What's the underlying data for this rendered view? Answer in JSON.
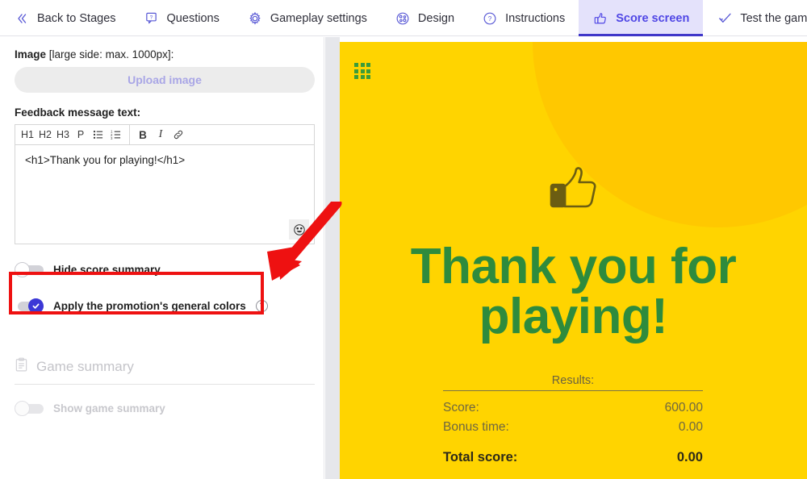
{
  "tabs": [
    {
      "label": "Back to Stages",
      "icon": "chevrons-left-icon",
      "active": false
    },
    {
      "label": "Questions",
      "icon": "question-bubble-icon",
      "active": false
    },
    {
      "label": "Gameplay settings",
      "icon": "gear-icon",
      "active": false
    },
    {
      "label": "Design",
      "icon": "palette-icon",
      "active": false
    },
    {
      "label": "Instructions",
      "icon": "question-circle-icon",
      "active": false
    },
    {
      "label": "Score screen",
      "icon": "thumbs-up-icon",
      "active": true
    },
    {
      "label": "Test the game",
      "icon": "check-wave-icon",
      "active": false
    }
  ],
  "editor": {
    "image_label_strong": "Image",
    "image_label_rest": " [large side: max. 1000px]:",
    "upload_button": "Upload image",
    "feedback_label": "Feedback message text:",
    "toolbar": [
      "H1",
      "H2",
      "H3",
      "P",
      "bulleted-list-icon",
      "numbered-list-icon",
      "B",
      "I",
      "link-icon"
    ],
    "content": "<h1>Thank you for playing!</h1>",
    "emoji_button": "☺"
  },
  "toggles": [
    {
      "label": "Hide score summary",
      "state": "off",
      "help": false,
      "disabled": false
    },
    {
      "label": "Apply the promotion's general colors",
      "state": "on",
      "help": true,
      "help_glyph": "?",
      "disabled": false
    }
  ],
  "game_summary": {
    "placeholder": "Game summary",
    "icon": "clipboard-icon",
    "toggle_label": "Show game summary",
    "toggle_state": "off"
  },
  "preview": {
    "grid_icon": "grid-menu-icon",
    "thumb_icon": "thumbs-up-icon",
    "title": "Thank you for playing!",
    "results_title": "Results:",
    "rows": [
      {
        "label": "Score:",
        "value": "600.00"
      },
      {
        "label": "Bonus time:",
        "value": "0.00"
      }
    ],
    "total": {
      "label": "Total score:",
      "value": "0.00"
    }
  },
  "colors": {
    "accent": "#4f46e5",
    "toggle_on": "#3b38d6",
    "preview_bg": "#ffd400",
    "preview_title": "#2e8b3d",
    "grid_green": "#3a9c3a",
    "annotation_red": "#ee1111"
  }
}
